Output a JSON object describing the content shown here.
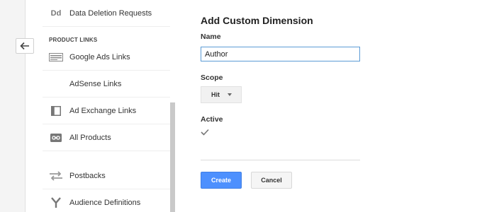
{
  "sidebar": {
    "section_header": "PRODUCT LINKS",
    "items": [
      {
        "label": "Data Deletion Requests",
        "icon": "dd-icon"
      },
      {
        "label": "Google Ads Links",
        "icon": "ads-icon"
      },
      {
        "label": "AdSense Links",
        "icon": ""
      },
      {
        "label": "Ad Exchange Links",
        "icon": "ad-exchange-icon"
      },
      {
        "label": "All Products",
        "icon": "link-icon"
      },
      {
        "label": "Postbacks",
        "icon": "postbacks-icon"
      },
      {
        "label": "Audience Definitions",
        "icon": "audience-icon"
      }
    ],
    "dd_icon_text": "Dd"
  },
  "form": {
    "title": "Add Custom Dimension",
    "name_label": "Name",
    "name_value": "Author",
    "scope_label": "Scope",
    "scope_value": "Hit",
    "active_label": "Active",
    "active_checked": true,
    "create_label": "Create",
    "cancel_label": "Cancel"
  },
  "colors": {
    "primary_button": "#4d90fe",
    "input_focus_border": "#5b9bd5"
  }
}
